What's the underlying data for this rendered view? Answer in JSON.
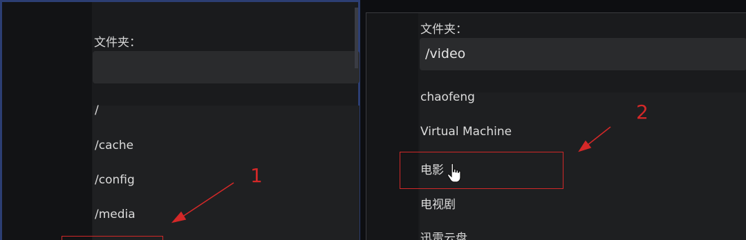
{
  "left": {
    "label": "文件夹：",
    "input_value": "",
    "items": [
      "/",
      "/cache",
      "/config",
      "/media"
    ]
  },
  "right": {
    "label": "文件夹：",
    "input_value": "/video",
    "items": [
      "chaofeng",
      "Virtual Machine",
      "电影",
      "电视剧",
      "迅雷云盘"
    ]
  },
  "annotations": {
    "step1": "1",
    "step2": "2",
    "color": "#d42828"
  }
}
